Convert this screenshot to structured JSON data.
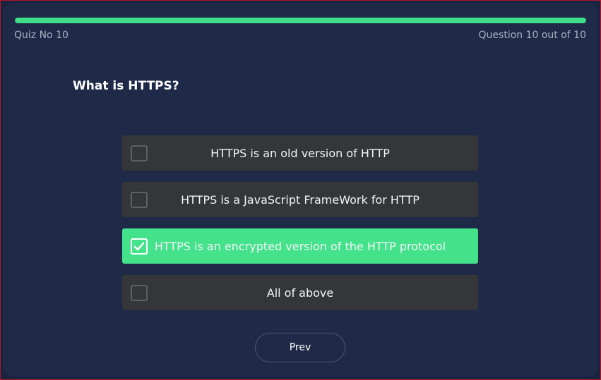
{
  "progress": {
    "value": 1.0,
    "color": "#3fdf8a"
  },
  "header": {
    "quiz_label": "Quiz No 10",
    "question_counter": "Question 10 out of 10"
  },
  "question": {
    "text": "What is HTTPS?"
  },
  "options": [
    {
      "label": "HTTPS is an old version of HTTP",
      "selected": false
    },
    {
      "label": "HTTPS is a JavaScript FrameWork for HTTP",
      "selected": false
    },
    {
      "label": "HTTPS is an encrypted version of the HTTP protocol",
      "selected": true
    },
    {
      "label": "All of above",
      "selected": false
    }
  ],
  "navigation": {
    "prev_label": "Prev"
  },
  "colors": {
    "background": "#1f2a48",
    "option": "#343637",
    "selected": "#45e28c",
    "frame_border": "#b0152a"
  }
}
